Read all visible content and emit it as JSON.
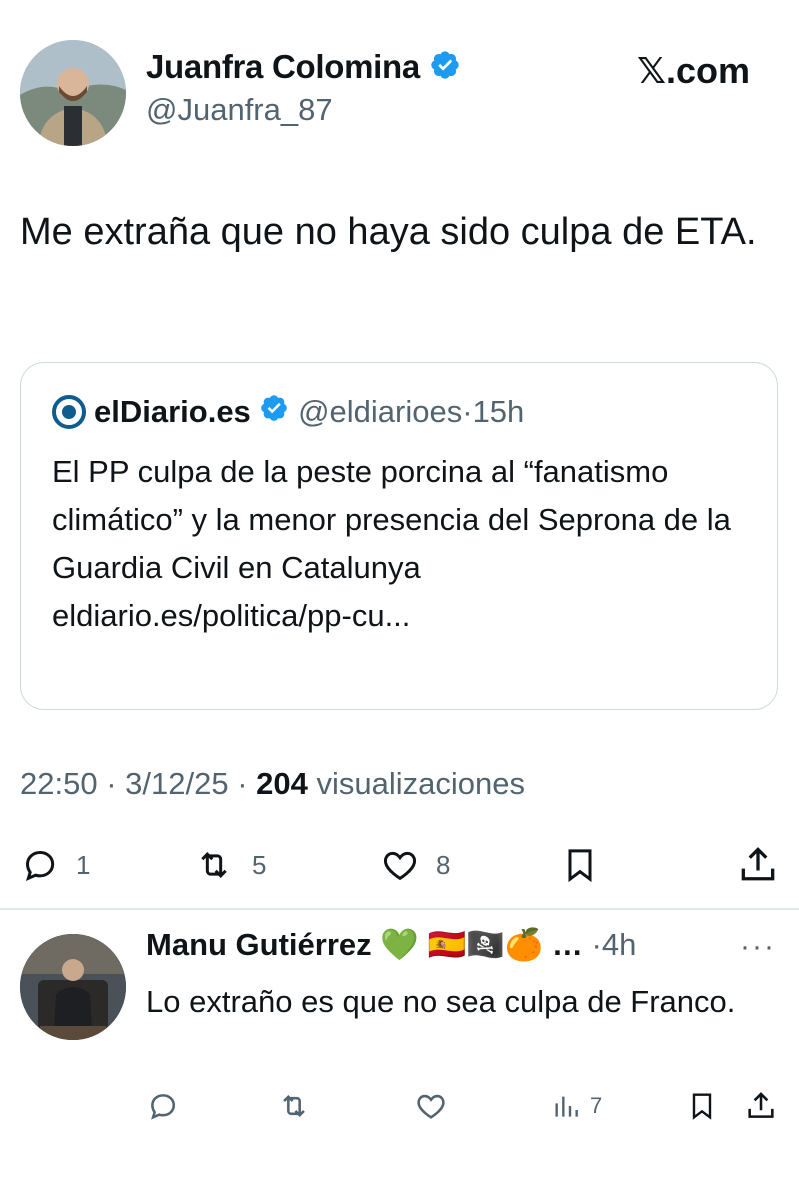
{
  "tweet": {
    "author_name": "Juanfra Colomina",
    "author_handle": "@Juanfra_87",
    "verified": true,
    "brand": "𝕏.com",
    "text": "Me extraña que no haya sido culpa de ETA.",
    "quote": {
      "author_name": "elDiario.es",
      "author_handle": "@eldiarioes",
      "separator": "·",
      "time": "15h",
      "text": "El PP culpa de la peste porcina al “fanatismo climático” y la menor presencia del Seprona de la Guardia Civil en Catalunya",
      "link": "eldiario.es/politica/pp-cu..."
    },
    "meta": {
      "time": "22:50",
      "separator": "·",
      "date": "3/12/25",
      "views_count": "204",
      "views_label": "visualizaciones"
    },
    "actions": {
      "replies": "1",
      "retweets": "5",
      "likes": "8"
    }
  },
  "reply": {
    "author_name": "Manu Gutiérrez",
    "name_emojis": "💚 🇪🇸🏴‍☠️🍊",
    "ellipsis": "…",
    "separator": "·",
    "time": "4h",
    "more": "···",
    "text": "Lo extraño es que no sea culpa de Franco.",
    "actions": {
      "views": "7"
    }
  },
  "colors": {
    "verified_blue": "#1d9bf0",
    "muted_text": "#536471",
    "border": "#cfd9de"
  }
}
